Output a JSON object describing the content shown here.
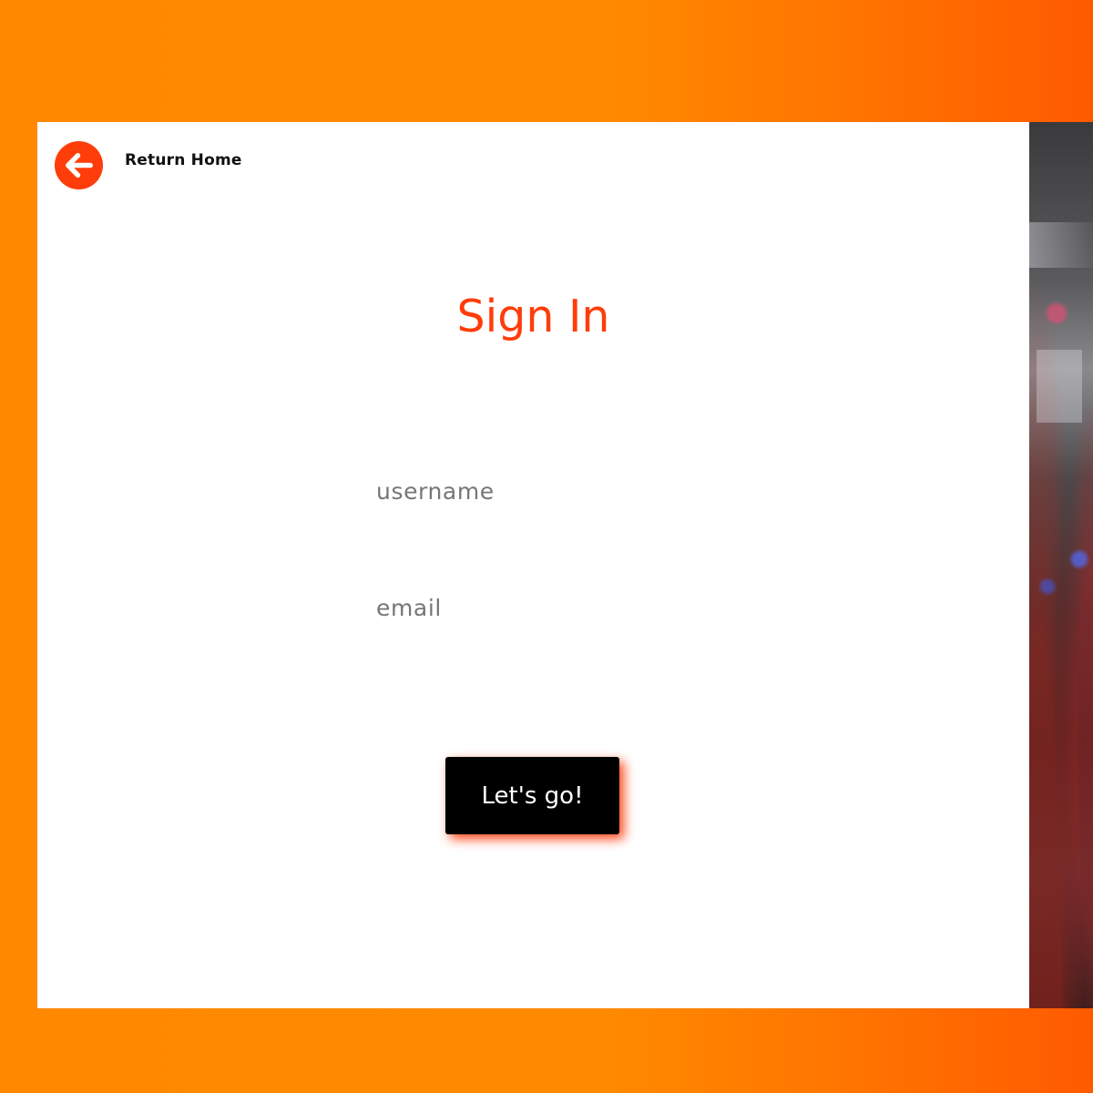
{
  "header": {
    "return_label": "Return Home",
    "return_icon": "arrow-left-circle-icon"
  },
  "form": {
    "title": "Sign In",
    "username_placeholder": "username",
    "email_placeholder": "email",
    "submit_label": "Let's go!"
  },
  "colors": {
    "accent": "#ff3d0a",
    "background_gradient_start": "#ff8800",
    "background_gradient_end": "#ff5a00",
    "card": "#ffffff",
    "button": "#000000"
  }
}
